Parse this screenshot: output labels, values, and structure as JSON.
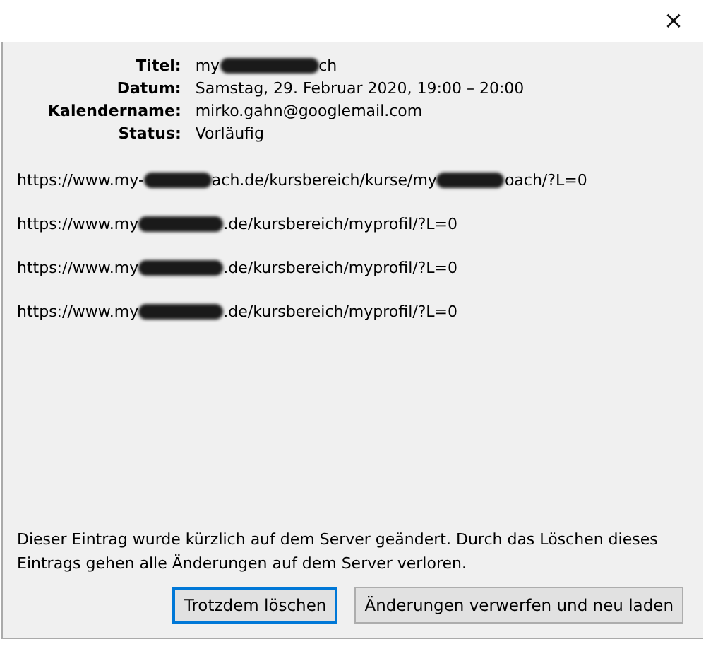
{
  "window": {
    "close": "×"
  },
  "details": [
    {
      "label": "Titel:",
      "segments": [
        "my",
        "ch"
      ]
    },
    {
      "label": "Datum:",
      "segments": [
        "Samstag, 29. Februar 2020, 19:00 – 20:00"
      ]
    },
    {
      "label": "Kalendername:",
      "segments": [
        "mirko.gahn@googlemail.com"
      ]
    },
    {
      "label": "Status:",
      "segments": [
        "Vorläufig"
      ]
    }
  ],
  "links": [
    {
      "segments": [
        "https://www.my-",
        "ach.de/kursbereich/kurse/my",
        "oach/?L=0"
      ]
    },
    {
      "segments": [
        "https://www.my",
        ".de/kursbereich/myprofil/?L=0"
      ]
    },
    {
      "segments": [
        "https://www.my",
        ".de/kursbereich/myprofil/?L=0"
      ]
    },
    {
      "segments": [
        "https://www.my",
        ".de/kursbereich/myprofil/?L=0"
      ]
    }
  ],
  "message": "Dieser Eintrag wurde kürzlich auf dem Server geändert. Durch das Löschen dieses Eintrags gehen alle Änderungen auf dem Server verloren.",
  "buttons": [
    {
      "label": "Trotzdem löschen",
      "selected": true
    },
    {
      "label": "Änderungen verwerfen und neu laden",
      "selected": false
    }
  ]
}
